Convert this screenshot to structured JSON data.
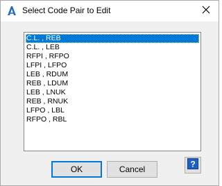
{
  "dialog": {
    "title": "Select Code Pair to Edit",
    "icon": "autocad-a-icon",
    "close_icon": "close-icon"
  },
  "list": {
    "items": [
      {
        "label": "C.L. , REB",
        "selected": true
      },
      {
        "label": "C.L. , LEB",
        "selected": false
      },
      {
        "label": "RFPI , RFPO",
        "selected": false
      },
      {
        "label": "LFPI , LFPO",
        "selected": false
      },
      {
        "label": "LEB , RDUM",
        "selected": false
      },
      {
        "label": "REB , LDUM",
        "selected": false
      },
      {
        "label": "LEB , LNUK",
        "selected": false
      },
      {
        "label": "REB , RNUK",
        "selected": false
      },
      {
        "label": "LFPO , LBL",
        "selected": false
      },
      {
        "label": "RFPO , RBL",
        "selected": false
      }
    ]
  },
  "buttons": {
    "ok_label": "OK",
    "cancel_label": "Cancel",
    "help_icon": "help-question-icon"
  },
  "colors": {
    "selection": "#0078d7",
    "default_button_border": "#0078d7",
    "help_icon_bg": "#1f5fbf"
  }
}
